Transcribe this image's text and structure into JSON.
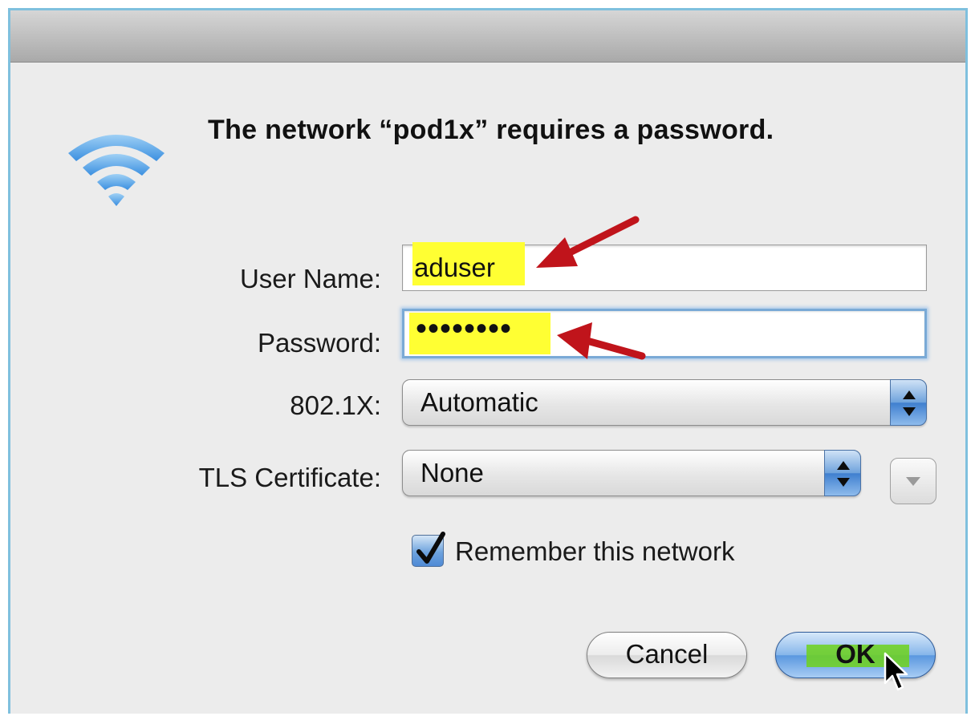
{
  "dialog": {
    "heading": "The network “pod1x” requires a password.",
    "icon": "wifi-icon"
  },
  "form": {
    "username_label": "User Name:",
    "username_value": "aduser",
    "password_label": "Password:",
    "password_value": "••••••••",
    "eap_label": "802.1X:",
    "eap_value": "Automatic",
    "tls_label": "TLS Certificate:",
    "tls_value": "None",
    "remember_label": "Remember this network",
    "remember_checked": true
  },
  "buttons": {
    "cancel": "Cancel",
    "ok": "OK"
  },
  "colors": {
    "highlight": "#ffff33",
    "annotation_arrow": "#c0141b",
    "ok_highlight": "#6fd21c",
    "aqua_blue": "#5a97df"
  }
}
